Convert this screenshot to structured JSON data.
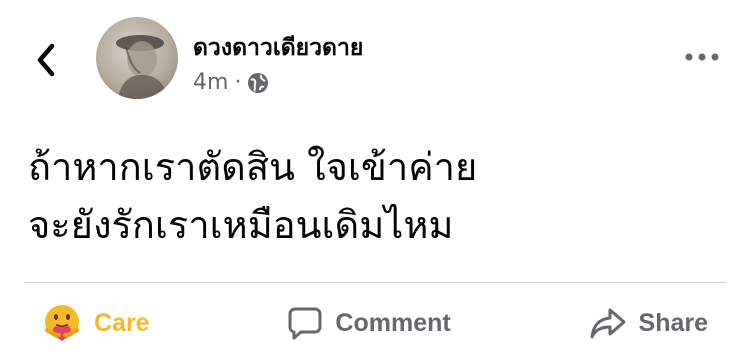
{
  "post": {
    "author": "ดวงดาวเดียวดาย",
    "time": "4m",
    "separator": "·",
    "audience_icon": "globe-icon",
    "text_lines": [
      "ถ้าหากเราตัดสิน ใจเข้าค่าย",
      "จะยังรักเราเหมือนเดิมไหม"
    ]
  },
  "header": {
    "back_icon": "chevron-left-icon",
    "more_icon": "more-dots-icon"
  },
  "actions": {
    "care_label": "Care",
    "comment_label": "Comment",
    "share_label": "Share"
  },
  "colors": {
    "care": "#f7b928",
    "secondary_text": "#65676b",
    "divider": "#ced0d4"
  }
}
